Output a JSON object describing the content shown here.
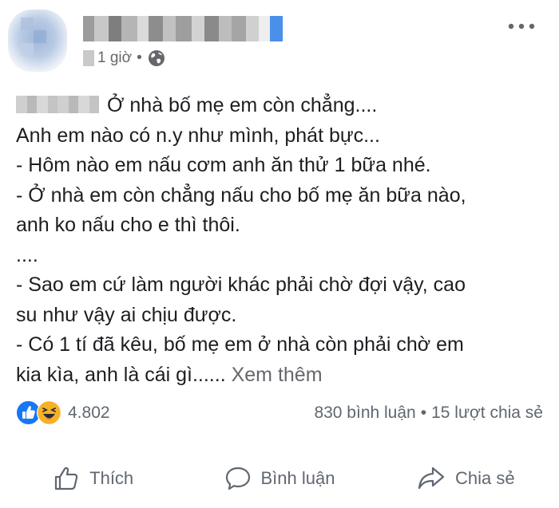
{
  "post": {
    "time": "1 giờ",
    "separator": "•",
    "lines": [
      "Ở nhà bố mẹ em còn chẳng....",
      "Anh em nào có n.y như mình, phát bực...",
      "- Hôm nào em nấu cơm anh ăn thử 1 bữa nhé.",
      "- Ở nhà em còn chẳng nấu cho bố mẹ ăn bữa nào,",
      "anh ko nấu cho e thì thôi.",
      "....",
      "- Sao em cứ làm người khác phải chờ đợi vậy, cao",
      "su như vậy ai chịu được.",
      "- Có 1 tí đã kêu, bố mẹ em ở nhà còn phải chờ em",
      "kia kìa, anh là cái gì......"
    ],
    "see_more": "Xem thêm"
  },
  "stats": {
    "reactions_count": "4.802",
    "comments": "830 bình luận",
    "separator": "•",
    "shares": "15 lượt chia sẻ"
  },
  "actions": {
    "like": "Thích",
    "comment": "Bình luận",
    "share": "Chia sẻ"
  },
  "icons": {
    "reactions": [
      "like-icon",
      "haha-icon"
    ],
    "privacy": "globe-icon",
    "more": "more-options-icon"
  },
  "colors": {
    "like_blue": "#1877f2",
    "haha_yellow": "#f7b125",
    "text": "#1c1e21",
    "secondary_text": "#65676b"
  }
}
